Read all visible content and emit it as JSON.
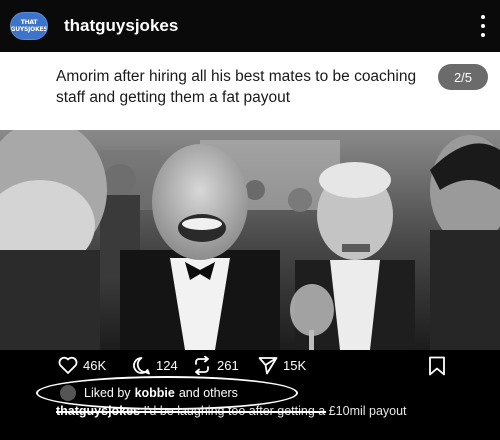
{
  "header": {
    "avatar_text_1": "THAT",
    "avatar_text_2": "GUYSJOKES",
    "username": "thatguysjokes",
    "more_icon": "vertical-ellipsis-icon"
  },
  "post": {
    "caption": "Amorim after hiring all his best mates to be coaching staff and getting them a fat payout",
    "slide_counter": "2/5",
    "photo_description_icon": "photo"
  },
  "actions": {
    "likes": "46K",
    "comments": "124",
    "reposts": "261",
    "shares": "15K",
    "icons": {
      "like": "heart-icon",
      "comment": "comment-bubble-icon",
      "repost": "repost-icon",
      "share": "send-icon",
      "save": "bookmark-icon"
    }
  },
  "liked_by": {
    "prefix": "Liked by",
    "user": "kobbie",
    "suffix": "and others"
  },
  "comment": {
    "author": "thatguysjokes",
    "text": "I'd be laughing too after getting a £10mil payout"
  },
  "colors": {
    "background": "#000000",
    "slide_background": "#ffffff",
    "counter_badge": "#6b6b6b",
    "avatar": "#3d74c9"
  }
}
